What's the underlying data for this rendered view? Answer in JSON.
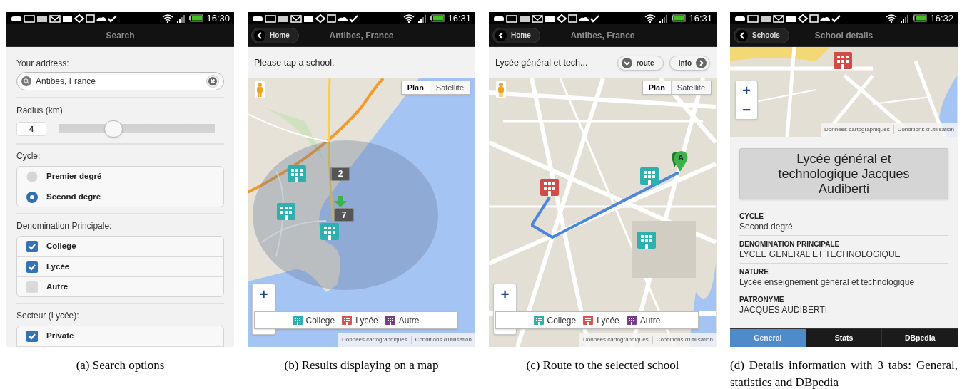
{
  "search_screen": {
    "status_time": "16:30",
    "title": "Search",
    "address_label": "Your address:",
    "address_value": "Antibes, France",
    "radius_label": "Radius (km)",
    "radius": {
      "value": "4",
      "level": 0.33
    },
    "groups": [
      {
        "label": "Cycle:",
        "kind": "radio",
        "options": [
          {
            "label": "Premier degré",
            "selected": false
          },
          {
            "label": "Second degré",
            "selected": true
          }
        ]
      },
      {
        "label": "Denomination Principale:",
        "kind": "checkbox",
        "options": [
          {
            "label": "College",
            "checked": true
          },
          {
            "label": "Lycée",
            "checked": true
          },
          {
            "label": "Autre",
            "checked": false
          }
        ]
      },
      {
        "label": "Secteur (Lycée):",
        "kind": "checkbox",
        "options": [
          {
            "label": "Private",
            "checked": true
          }
        ]
      }
    ]
  },
  "map_screen": {
    "status_time": "16:31",
    "back": "Home",
    "title": "Antibes, France",
    "prompt": "Please tap a school.",
    "map_types": [
      {
        "label": "Plan",
        "selected": true
      },
      {
        "label": "Satellite",
        "selected": false
      }
    ],
    "markers": [
      {
        "kind": "college"
      },
      {
        "kind": "college"
      },
      {
        "kind": "college"
      },
      {
        "kind": "cluster",
        "count": "2"
      },
      {
        "kind": "arrow"
      },
      {
        "kind": "cluster",
        "count": "7"
      }
    ],
    "zoom": [
      "+"
    ],
    "legend": [
      {
        "label": "College",
        "color": "#2fb0b0"
      },
      {
        "label": "Lycée",
        "color": "#d9534f"
      },
      {
        "label": "Autre",
        "color": "#7a3d8c"
      }
    ],
    "attribution": [
      "Données cartographiques",
      "Conditions d'utilisation"
    ]
  },
  "route_screen": {
    "status_time": "16:31",
    "back": "Home",
    "title": "Antibes, France",
    "selected_school": "Lycée général et tech...",
    "buttons": [
      {
        "label": "route",
        "kind": "route"
      },
      {
        "label": "info",
        "kind": "info"
      }
    ],
    "map_types": [
      {
        "label": "Plan",
        "selected": true
      },
      {
        "label": "Satellite",
        "selected": false
      }
    ],
    "markers": [
      {
        "kind": "lycee"
      },
      {
        "kind": "college"
      },
      {
        "kind": "college"
      },
      {
        "kind": "pin",
        "label": "A"
      }
    ],
    "zoom": [
      "+"
    ],
    "legend": [
      {
        "label": "College",
        "color": "#2fb0b0"
      },
      {
        "label": "Lycée",
        "color": "#d9534f"
      },
      {
        "label": "Autre",
        "color": "#7a3d8c"
      }
    ],
    "attribution": [
      "Données cartographiques",
      "Conditions d'utilisation"
    ]
  },
  "details_screen": {
    "status_time": "16:32",
    "back": "Schools",
    "title": "School details",
    "markers": [
      {
        "kind": "lycee"
      }
    ],
    "zoom": [
      "+",
      "−"
    ],
    "attribution": [
      "Données cartographiques",
      "Conditions d'utilisation"
    ],
    "school_name": "Lycée général et technologique Jacques Audiberti",
    "fields": [
      {
        "label": "CYCLE",
        "value": "Second degré"
      },
      {
        "label": "DENOMINATION PRINCIPALE",
        "value": "LYCEE GENERAL ET TECHNOLOGIQUE"
      },
      {
        "label": "NATURE",
        "value": "Lycée enseignement général et technologique"
      },
      {
        "label": "PATRONYME",
        "value": "JACQUES AUDIBERTI"
      }
    ],
    "tabs": [
      {
        "label": "General",
        "selected": true
      },
      {
        "label": "Stats",
        "selected": false
      },
      {
        "label": "DBpedia",
        "selected": false
      }
    ]
  },
  "captions": [
    "(a)  Search options",
    "(b)  Results displaying on a map",
    "(c)  Route to the selected school",
    "(d)  Details information with 3 tabs: General, statistics and DBpedia"
  ]
}
